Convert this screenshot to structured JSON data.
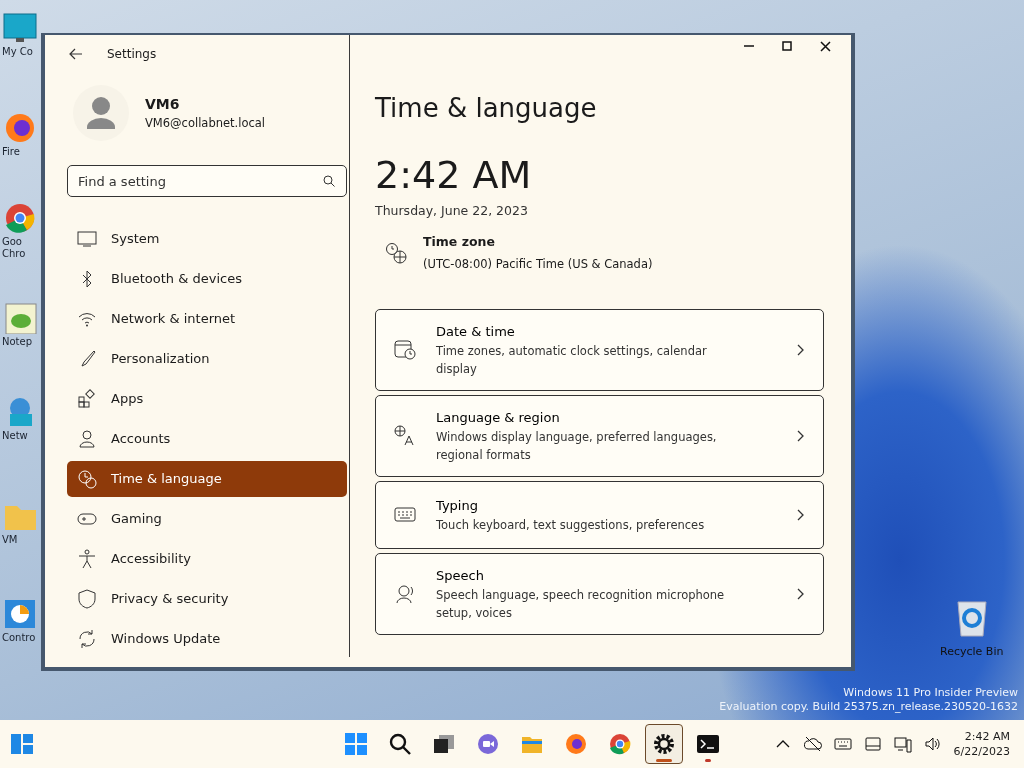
{
  "desktop_icons": [
    {
      "lines": [
        "My Co"
      ]
    },
    {
      "lines": [
        "Fire"
      ]
    },
    {
      "lines": [
        "Goo",
        "Chro"
      ]
    },
    {
      "lines": [
        "Notep"
      ]
    },
    {
      "lines": [
        "Netw"
      ]
    },
    {
      "lines": [
        "VM"
      ]
    },
    {
      "lines": [
        "Contro"
      ]
    }
  ],
  "recycle_bin": {
    "label": "Recycle Bin"
  },
  "system_notice": [
    "Windows 11 Pro Insider Preview",
    "Evaluation copy. Build 25375.zn_release.230520-1632"
  ],
  "window": {
    "title": "Settings",
    "account": {
      "name": "VM6",
      "email": "VM6@collabnet.local"
    },
    "search": {
      "placeholder": "Find a setting"
    },
    "nav": [
      {
        "label": "System",
        "selected": false
      },
      {
        "label": "Bluetooth & devices",
        "selected": false
      },
      {
        "label": "Network & internet",
        "selected": false
      },
      {
        "label": "Personalization",
        "selected": false
      },
      {
        "label": "Apps",
        "selected": false
      },
      {
        "label": "Accounts",
        "selected": false
      },
      {
        "label": "Time & language",
        "selected": true
      },
      {
        "label": "Gaming",
        "selected": false
      },
      {
        "label": "Accessibility",
        "selected": false
      },
      {
        "label": "Privacy & security",
        "selected": false
      },
      {
        "label": "Windows Update",
        "selected": false
      }
    ],
    "page_title": "Time & language",
    "clock": "2:42 AM",
    "date": "Thursday, June 22, 2023",
    "time_zone": {
      "title": "Time zone",
      "value": "(UTC-08:00) Pacific Time (US & Canada)"
    },
    "cards": [
      {
        "title": "Date & time",
        "description": "Time zones, automatic clock settings, calendar display"
      },
      {
        "title": "Language & region",
        "description": "Windows display language, preferred languages, regional formats"
      },
      {
        "title": "Typing",
        "description": "Touch keyboard, text suggestions, preferences"
      },
      {
        "title": "Speech",
        "description": "Speech language, speech recognition microphone setup, voices"
      }
    ]
  },
  "taskbar": {
    "apps": [
      {
        "selected": false,
        "running": false
      },
      {
        "selected": false,
        "running": false
      },
      {
        "selected": false,
        "running": false
      },
      {
        "selected": false,
        "running": false
      },
      {
        "selected": false,
        "running": false
      },
      {
        "selected": false,
        "running": false
      },
      {
        "selected": false,
        "running": false
      },
      {
        "selected": true,
        "running": true
      },
      {
        "selected": false,
        "running": true
      }
    ],
    "time": "2:42 AM",
    "date": "6/22/2023"
  }
}
